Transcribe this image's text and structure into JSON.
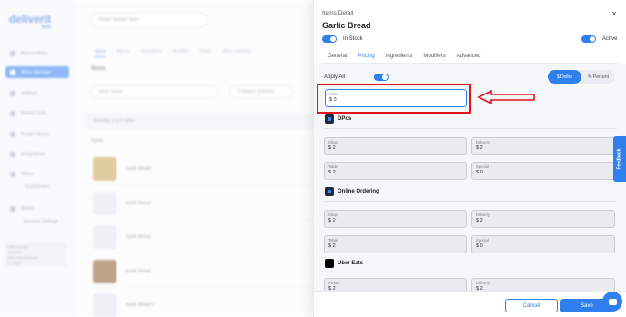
{
  "background": {
    "logo": "deliverit",
    "logo_sub": "beta",
    "sidebar": [
      {
        "label": "Placed Menu"
      },
      {
        "label": "Menu Manager"
      },
      {
        "label": "Settings"
      },
      {
        "label": "Promo Code"
      },
      {
        "label": "Image Library"
      },
      {
        "label": "Integrations"
      },
      {
        "label": "Offers"
      },
      {
        "label": "Admin"
      }
    ],
    "sidebar_subs": [
      "Touchscreen",
      "Account Settings"
    ],
    "user_lines": [
      "Mira Kessler",
      "Hi-4520",
      "Mira Label Kessler",
      "Hi-4520"
    ],
    "store_select": "Doubt Sender Store",
    "tabs": [
      "Items",
      "Menus",
      "Ingredient",
      "Modifier",
      "Deals",
      "Menu Settings"
    ],
    "items_heading": "Items",
    "search_placeholder": "garlic bread",
    "category_placeholder": "Category selected",
    "showing": "Showing 1 to 6 items",
    "name_header": "Name",
    "rows": [
      "Garlic Bread",
      "Garlic Bread",
      "Garlic Bread",
      "Garlic Bread",
      "Garlic Bread",
      "Garlic Bread 2"
    ]
  },
  "modal": {
    "header": "Items Detail",
    "close": "×",
    "title": "Garlic Bread",
    "in_stock_label": "In Stock",
    "active_label": "Active",
    "tabs": [
      {
        "label": "General"
      },
      {
        "label": "Pricing"
      },
      {
        "label": "Ingredients"
      },
      {
        "label": "Modifiers"
      },
      {
        "label": "Advanced"
      }
    ],
    "active_tab": "Pricing",
    "apply_all": "Apply All",
    "mode": {
      "dollar": "$ Dollar",
      "percent": "% Percent"
    },
    "price": {
      "label": "Price",
      "value": "$ 3"
    },
    "sections": [
      {
        "name": "DPos",
        "fields": [
          {
            "label": "Shop",
            "value": "$ 2"
          },
          {
            "label": "Delivery",
            "value": "$ 2"
          },
          {
            "label": "Table",
            "value": "$ 2"
          },
          {
            "label": "Special",
            "value": "$ 0"
          }
        ]
      },
      {
        "name": "Online Ordering",
        "fields": [
          {
            "label": "Shop",
            "value": "$ 2"
          },
          {
            "label": "Delivery",
            "value": "$ 2"
          },
          {
            "label": "Table",
            "value": "$ 2"
          },
          {
            "label": "Special",
            "value": "$ 0"
          }
        ]
      },
      {
        "name": "Uber Eats",
        "fields": [
          {
            "label": "Pickup",
            "value": "$ 2"
          },
          {
            "label": "Delivery",
            "value": "$ 2"
          }
        ]
      }
    ],
    "cancel": "Cancel",
    "save": "Save"
  },
  "feedback": "Feedback",
  "colors": {
    "accent": "#2f80ed",
    "highlight": "#e0141c"
  }
}
